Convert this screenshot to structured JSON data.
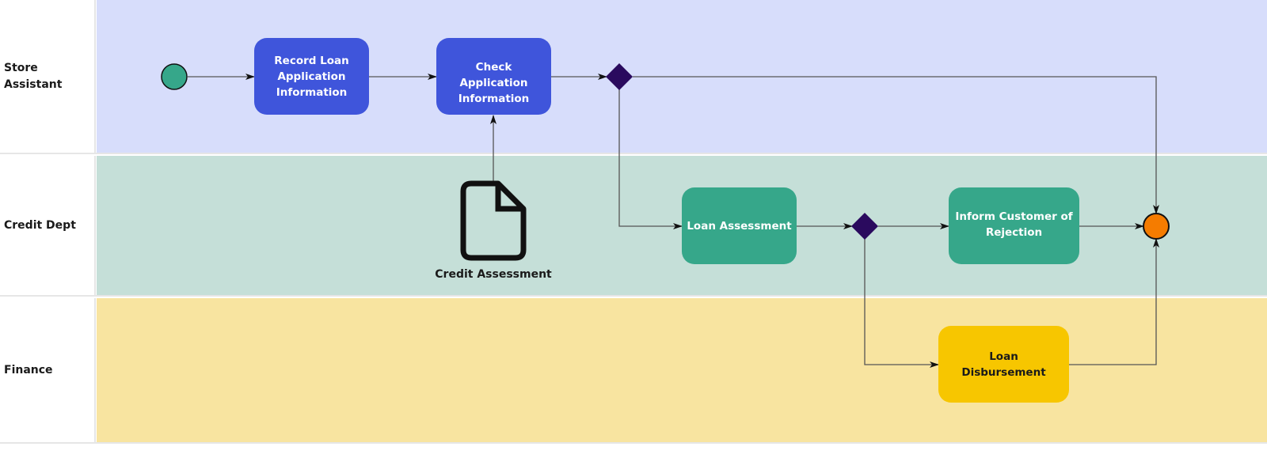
{
  "lanes": [
    {
      "label": "Store Assistant",
      "color": "#d7ddfb"
    },
    {
      "label": "Credit Dept",
      "color": "#c5dfd8"
    },
    {
      "label": "Finance",
      "color": "#f8e4a0"
    }
  ],
  "tasks": {
    "record": "Record Loan Application Information",
    "check": "Check Application Information",
    "assessment": "Loan Assessment",
    "inform": "Inform Customer of Rejection",
    "disbursement": "Loan Disbursement"
  },
  "artifact": {
    "label": "Credit Assessment",
    "icon": "document-icon"
  },
  "events": {
    "start": {
      "color": "#36a78a"
    },
    "end": {
      "color": "#f57c00"
    }
  },
  "gateway_color": "#2a0a5e"
}
